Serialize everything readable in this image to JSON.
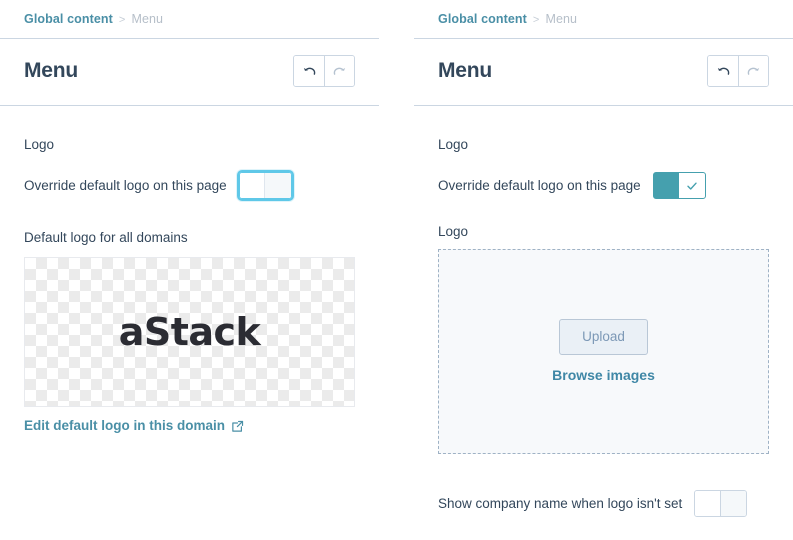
{
  "left_panel": {
    "breadcrumb": {
      "root": "Global content",
      "separator": ">",
      "current": "Menu"
    },
    "title": "Menu",
    "toolbar": {
      "undo_name": "undo-icon",
      "redo_name": "redo-icon"
    },
    "logo_section_label": "Logo",
    "override_label": "Override default logo on this page",
    "override_state": "off",
    "default_logo_heading": "Default logo for all domains",
    "logo_wordmark": "aStack",
    "edit_logo_link": "Edit default logo in this domain",
    "edit_logo_icon": "external-link-icon"
  },
  "right_panel": {
    "breadcrumb": {
      "root": "Global content",
      "separator": ">",
      "current": "Menu"
    },
    "title": "Menu",
    "toolbar": {
      "undo_name": "undo-icon",
      "redo_name": "redo-icon"
    },
    "logo_section_label": "Logo",
    "override_label": "Override default logo on this page",
    "override_state": "on",
    "logo_field_label": "Logo",
    "upload_button": "Upload",
    "browse_link": "Browse images",
    "show_company_name_label": "Show company name when logo isn't set",
    "show_company_name_state": "off"
  },
  "colors": {
    "link": "#4a8fa6",
    "text": "#33475b",
    "muted": "#b6bfc9",
    "border": "#cbd6e2",
    "toggle_on": "#45a0ae",
    "focus_ring": "#5fc8e8",
    "dropzone_bg": "#f7f9fb",
    "checker": "#ebebeb"
  }
}
